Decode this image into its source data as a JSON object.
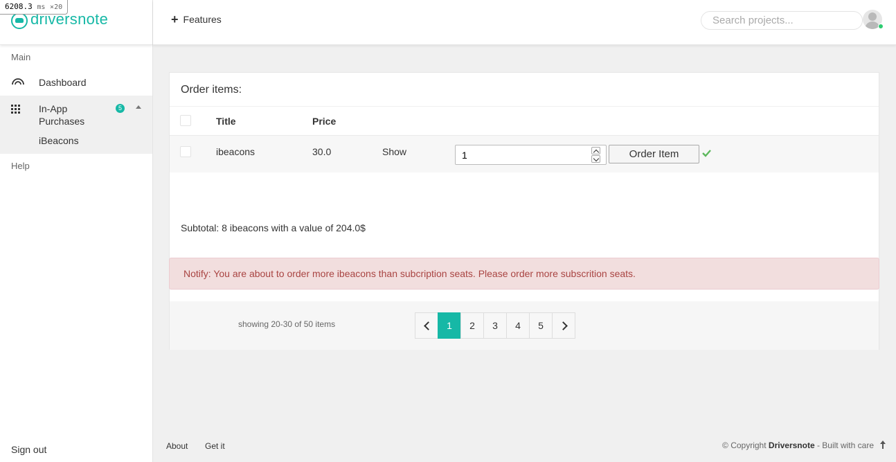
{
  "perf": {
    "value": "6208.3",
    "unit": "ms",
    "multiplier": "×20"
  },
  "brand": {
    "name": "driversnote",
    "color": "#16b8a6"
  },
  "sidebar": {
    "headings": {
      "main": "Main",
      "help": "Help"
    },
    "items": [
      {
        "label": "Dashboard",
        "icon": "dashboard-gauge-icon"
      },
      {
        "label": "In-App Purchases",
        "icon": "grid-icon",
        "badge": "5",
        "expanded": true
      }
    ],
    "subitems": [
      {
        "label": "iBeacons"
      }
    ],
    "signout": "Sign out"
  },
  "header": {
    "features_label": "Features",
    "search_placeholder": "Search projects..."
  },
  "order": {
    "title": "Order items:",
    "columns": {
      "title": "Title",
      "price": "Price"
    },
    "row": {
      "title": "ibeacons",
      "price": "30.0",
      "show": "Show",
      "quantity": "1",
      "order_button": "Order Item"
    },
    "subtotal": "Subtotal: 8 ibeacons with a value of 204.0$",
    "alert": "Notify: You are about to order more ibeacons than subcription seats. Please order more subscrition seats.",
    "showing": "showing 20-30 of 50 items",
    "pages": [
      "1",
      "2",
      "3",
      "4",
      "5"
    ],
    "active_page": "1"
  },
  "footer": {
    "links": [
      "About",
      "Get it"
    ],
    "copyright_prefix": "© Copyright",
    "copyright_brand": "Driversnote",
    "copyright_suffix": "- Built with care"
  },
  "colors": {
    "accent": "#16b8a6",
    "alert_bg": "#f2dede",
    "alert_text": "#a94442",
    "success": "#5cb85c"
  }
}
